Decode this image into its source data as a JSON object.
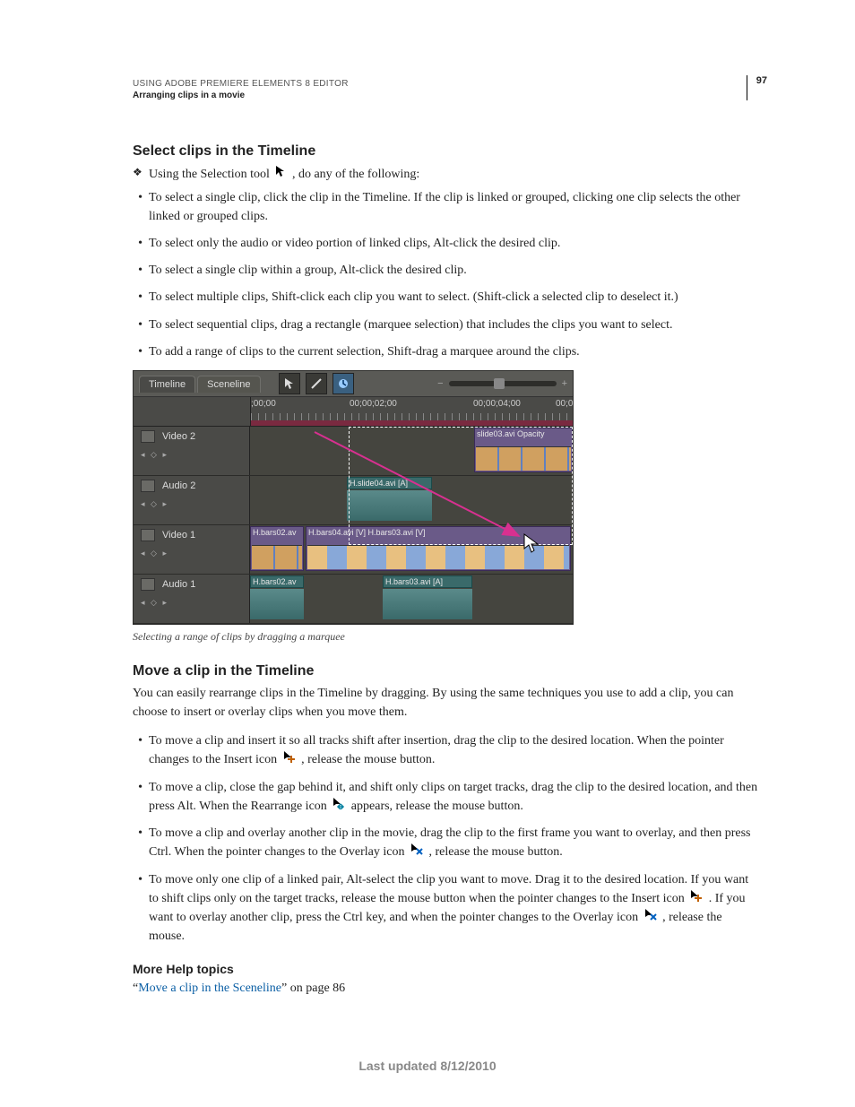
{
  "header": {
    "line1": "USING ADOBE PREMIERE ELEMENTS 8 EDITOR",
    "line2": "Arranging clips in a movie",
    "pageNumber": "97"
  },
  "sections": {
    "s1": {
      "title": "Select clips in the Timeline",
      "lead": "Using the Selection tool ",
      "leadTail": " , do any of the following:",
      "bullets": [
        "To select a single clip, click the clip in the Timeline. If the clip is linked or grouped, clicking one clip selects the other linked or grouped clips.",
        "To select only the audio or video portion of linked clips, Alt-click the desired clip.",
        "To select a single clip within a group, Alt-click the desired clip.",
        "To select multiple clips, Shift-click each clip you want to select. (Shift-click a selected clip to deselect it.)",
        "To select sequential clips, drag a rectangle (marquee selection) that includes the clips you want to select.",
        "To add a range of clips to the current selection, Shift-drag a marquee around the clips."
      ],
      "caption": "Selecting a range of clips by dragging a marquee"
    },
    "s2": {
      "title": "Move a clip in the Timeline",
      "intro": "You can easily rearrange clips in the Timeline by dragging. By using the same techniques you use to add a clip, you can choose to insert or overlay clips when you move them.",
      "bullets": [
        {
          "a": "To move a clip and insert it so all tracks shift after insertion, drag the clip to the desired location. When the pointer changes to the Insert icon ",
          "b": ", release the mouse button."
        },
        {
          "a": "To move a clip, close the gap behind it, and shift only clips on target tracks, drag the clip to the desired location, and then press Alt. When the Rearrange icon ",
          "b": " appears, release the mouse button."
        },
        {
          "a": "To move a clip and overlay another clip in the movie, drag the clip to the first frame you want to overlay, and then press Ctrl. When the pointer changes to the Overlay icon ",
          "b": ", release the mouse button."
        },
        {
          "a": "To move only one clip of a linked pair, Alt-select the clip you want to move. Drag it to the desired location. If you want to shift clips only on the target tracks, release the mouse button when the pointer changes to the Insert icon ",
          "b": ". If you want to overlay another clip, press the Ctrl key, and when the pointer changes to the Overlay icon ",
          "c": ", release the mouse."
        }
      ]
    },
    "help": {
      "title": "More Help topics",
      "q1": "“",
      "linkText": "Move a clip in the Sceneline",
      "q2": "” on page 86"
    }
  },
  "figure": {
    "tabs": {
      "timeline": "Timeline",
      "sceneline": "Sceneline"
    },
    "timecodes": {
      "t0": ";00;00",
      "t1": "00;00;02;00",
      "t2": "00;00;04;00",
      "t3": "00;0"
    },
    "tracks": {
      "v2": "Video 2",
      "a2": "Audio 2",
      "v1": "Video 1",
      "a1": "Audio 1"
    },
    "clips": {
      "slide03": "slide03.avi Opacity",
      "slide04": "H.slide04.avi [A]",
      "bars02v": "H.bars02.av",
      "bars04": "H.bars04.avi [V] H.bars03.avi [V]",
      "bars02a": "H.bars02.av",
      "bars03a": "H.bars03.avi [A]"
    },
    "zoomMinus": "−",
    "zoomPlus": "+"
  },
  "footer": "Last updated 8/12/2010"
}
